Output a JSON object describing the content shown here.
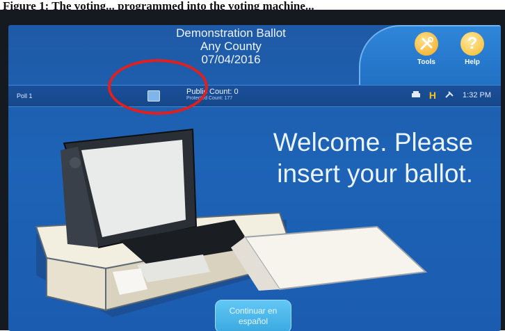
{
  "caption": "Figure 1: The voting... programmed into the voting machine...",
  "header": {
    "ballot_name": "Demonstration Ballot",
    "county": "Any County",
    "date": "07/04/2016"
  },
  "toolbar": {
    "tools_label": "Tools",
    "help_label": "Help",
    "help_glyph": "?"
  },
  "status": {
    "poll": "Poll 1",
    "public_count": "Public Count: 0",
    "protected_count": "Protected Count: 177",
    "time": "1:32 PM"
  },
  "main": {
    "welcome_line1": "Welcome. Please",
    "welcome_line2": "insert your ballot."
  },
  "language_button": {
    "line1": "Continuar en",
    "line2": "español"
  },
  "annotation_color": "#e0201f",
  "accent_color": "#f4b92a"
}
